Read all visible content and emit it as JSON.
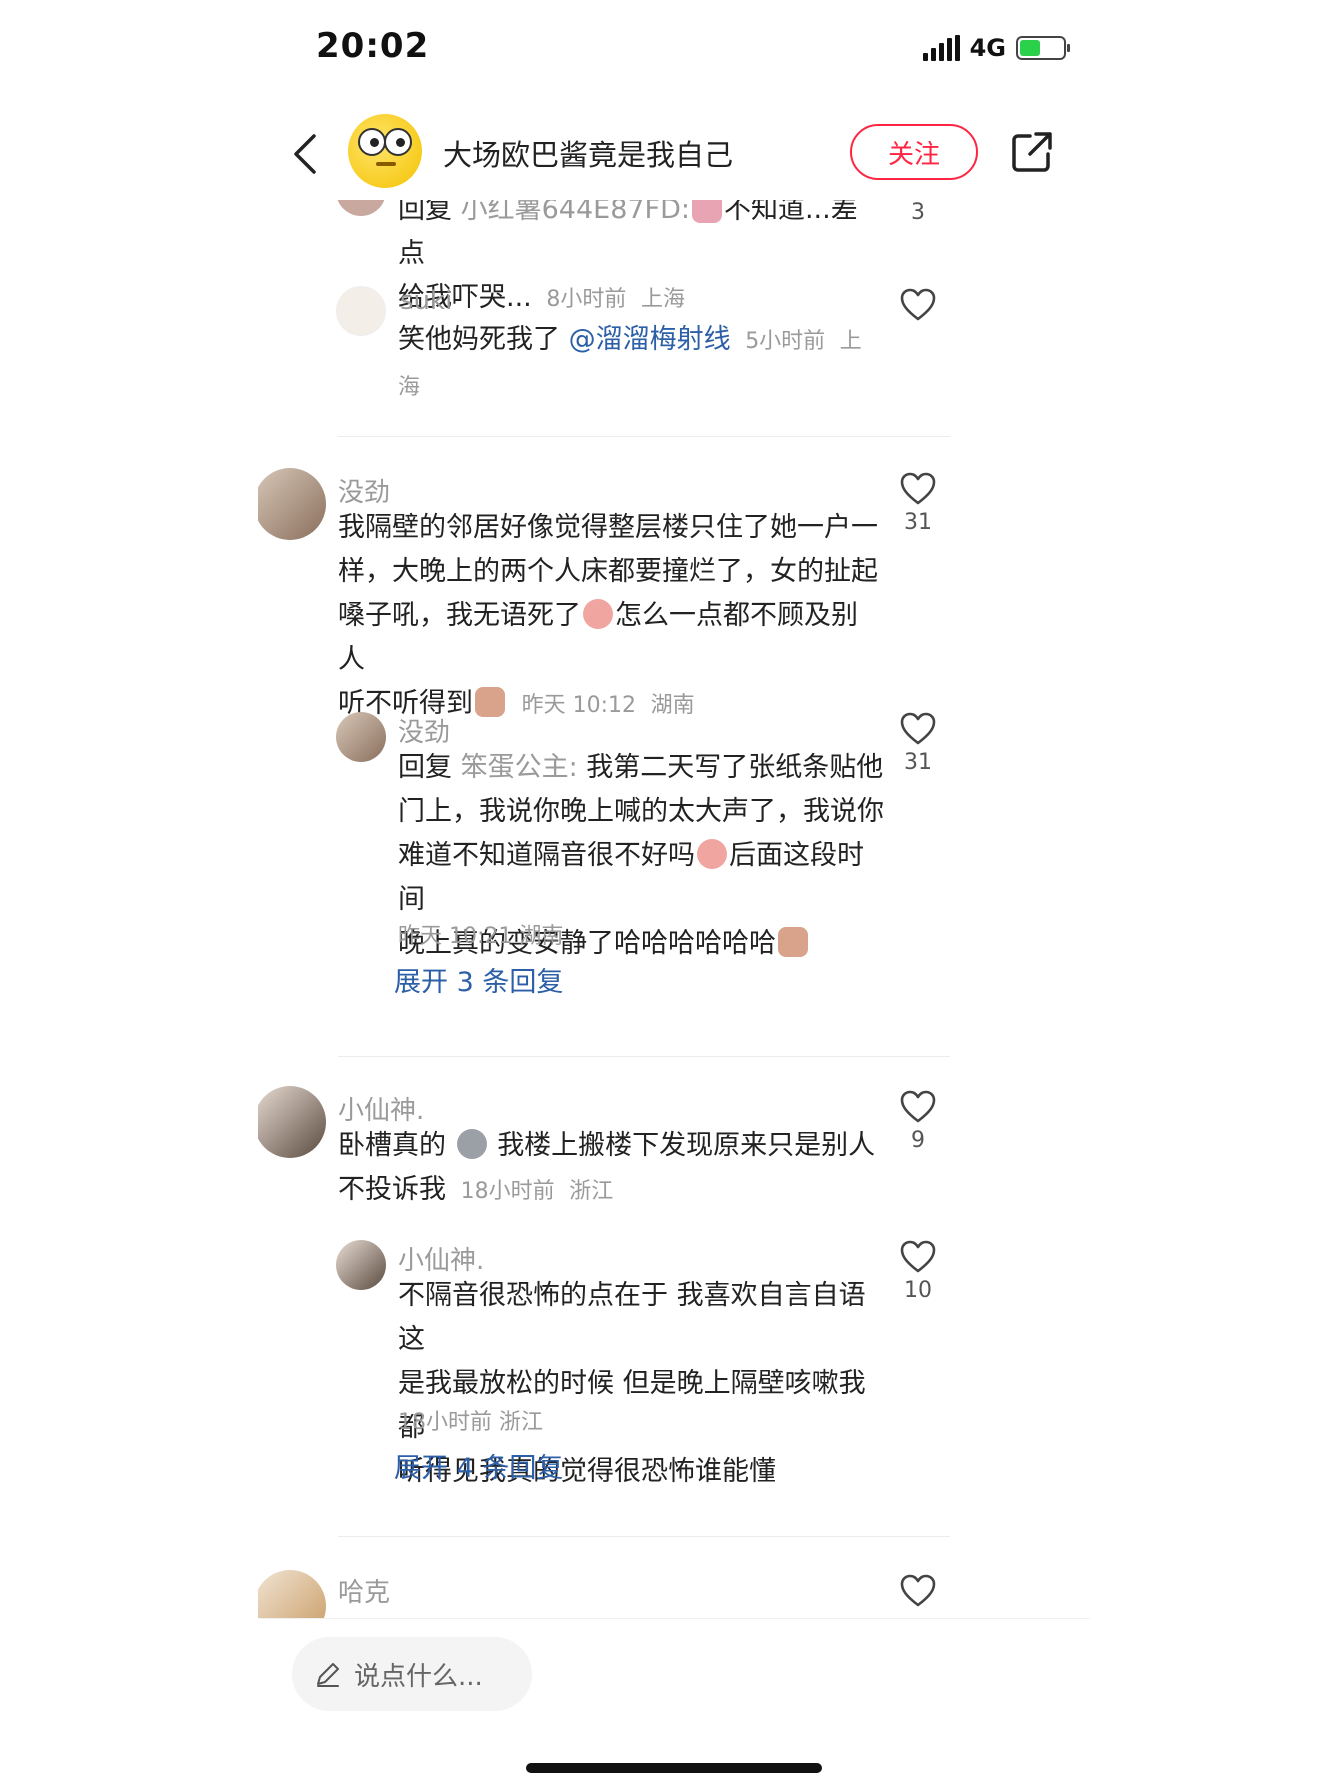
{
  "status": {
    "time": "20:02",
    "network": "4G"
  },
  "header": {
    "author_name": "大场欧巴酱竟是我自己",
    "follow_label": "关注"
  },
  "comments": [
    {
      "reply_prefix": "回复",
      "reply_to": "小红薯644E87FD:",
      "text_a": "不知道...差点",
      "text_b": "给我吓哭...",
      "time": "8小时前",
      "location": "上海",
      "likes": "3"
    },
    {
      "user": "suki",
      "text": "笑他妈死我了",
      "mention": "@溜溜梅射线",
      "time": "5小时前",
      "location": "上海"
    },
    {
      "user": "没劲",
      "line1": "我隔壁的邻居好像觉得整层楼只住了她一户一",
      "line2": "样，大晚上的两个人床都要撞烂了，女的扯起",
      "line3a": "嗓子吼，我无语死了",
      "line3b": "怎么一点都不顾及别人",
      "line4": "听不听得到",
      "time": "昨天 10:12",
      "location": "湖南",
      "likes": "31"
    },
    {
      "user": "没劲",
      "reply_prefix": "回复",
      "reply_to": "笨蛋公主:",
      "line1": "我第二天写了张纸条贴他",
      "line2": "门上，我说你晚上喊的太大声了，我说你",
      "line3a": "难道不知道隔音很不好吗",
      "line3b": "后面这段时间",
      "line4": "晚上真的变安静了哈哈哈哈哈哈",
      "time": "昨天 10:21",
      "location": "湖南",
      "likes": "31",
      "expand": "展开 3 条回复"
    },
    {
      "user": "小仙神.",
      "line1a": "卧槽真的",
      "line1b": "我楼上搬楼下发现原来只是别人",
      "line2": "不投诉我",
      "time": "18小时前",
      "location": "浙江",
      "likes": "9"
    },
    {
      "user": "小仙神.",
      "line1": "不隔音很恐怖的点在于 我喜欢自言自语这",
      "line2": "是我最放松的时候 但是晚上隔壁咳嗽我都",
      "line3": "听得见我真的觉得很恐怖谁能懂",
      "time": "18小时前",
      "location": "浙江",
      "likes": "10",
      "expand": "展开 4 条回复"
    },
    {
      "user": "哈克"
    }
  ],
  "input": {
    "placeholder": "说点什么..."
  },
  "colors": {
    "accent": "#ff2442",
    "link": "#2c5fa7",
    "muted": "#9a9a9a"
  },
  "icons": [
    "back-icon",
    "share-icon",
    "heart-icon",
    "pencil-icon",
    "signal-icon",
    "battery-icon"
  ]
}
